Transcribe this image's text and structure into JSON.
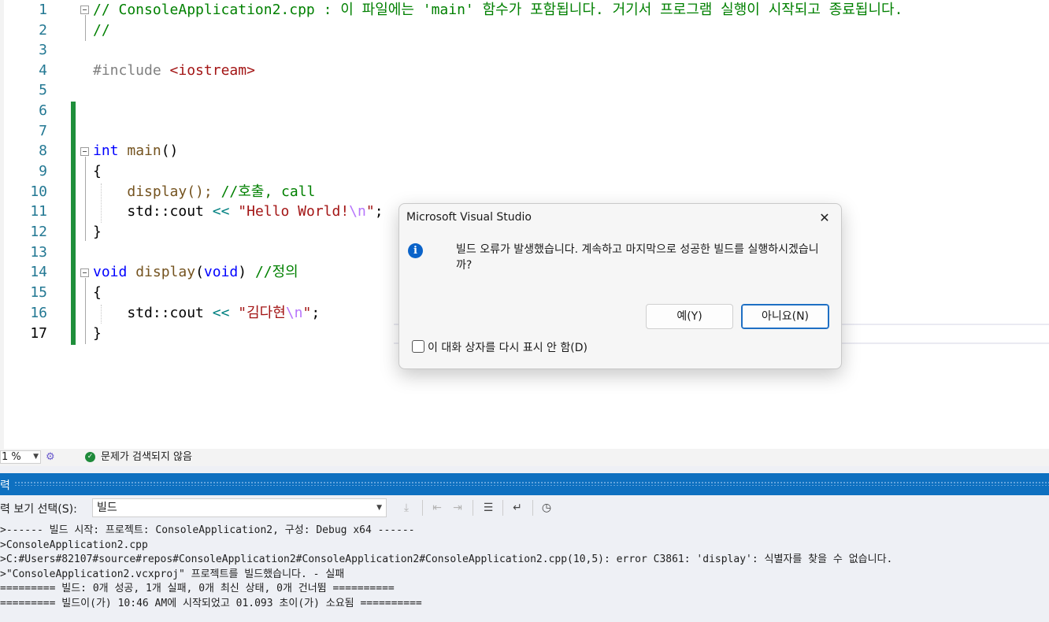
{
  "editor": {
    "line_numbers": [
      "1",
      "2",
      "3",
      "4",
      "5",
      "6",
      "7",
      "8",
      "9",
      "10",
      "11",
      "12",
      "13",
      "14",
      "15",
      "16",
      "17"
    ],
    "lines": {
      "l1": "// ConsoleApplication2.cpp : 이 파일에는 'main' 함수가 포함됩니다. 거기서 프로그램 실행이 시작되고 종료됩니다.",
      "l2": "//",
      "l4_directive": "#include",
      "l4_header": "<iostream>",
      "l8_kw": "int",
      "l8_fn": "main",
      "l8_rest": "()",
      "l9": "{",
      "l10_call": "display();",
      "l10_comment": "//호출, call",
      "l11_a": "std::cout",
      "l11_op": "<<",
      "l11_str1": "\"Hello World!",
      "l11_esc": "\\n",
      "l11_str2": "\"",
      "l11_end": ";",
      "l12": "}",
      "l14_kw": "void",
      "l14_fn": "display",
      "l14_p1": "(",
      "l14_kw2": "void",
      "l14_p2": ")",
      "l14_comment": "//정의",
      "l15": "{",
      "l16_a": "std::cout",
      "l16_op": "<<",
      "l16_str1": "\"김다현",
      "l16_esc": "\\n",
      "l16_str2": "\"",
      "l16_end": ";",
      "l17": "}"
    }
  },
  "statusbar": {
    "zoom": "1 %",
    "issues_text": "문제가 검색되지 않음"
  },
  "output_panel": {
    "title": "력",
    "show_output_label": "력 보기 선택(S):",
    "show_output_value": "빌드",
    "lines": [
      ">------ 빌드 시작: 프로젝트: ConsoleApplication2, 구성: Debug x64 ------",
      ">ConsoleApplication2.cpp",
      ">C:#Users#82107#source#repos#ConsoleApplication2#ConsoleApplication2#ConsoleApplication2.cpp(10,5): error C3861: 'display': 식별자를 찾을 수 없습니다.",
      ">\"ConsoleApplication2.vcxproj\" 프로젝트를 빌드했습니다. - 실패",
      "========= 빌드: 0개 성공, 1개 실패, 0개 최신 상태, 0개 건너뜀 ==========",
      "========= 빌드이(가) 10:46 AM에 시작되었고 01.093 초이(가) 소요됨 =========="
    ]
  },
  "dialog": {
    "title": "Microsoft Visual Studio",
    "message": "빌드 오류가 발생했습니다. 계속하고 마지막으로 성공한 빌드를 실행하시겠습니까?",
    "yes_label": "예(Y)",
    "no_label": "아니요(N)",
    "checkbox_label": "이 대화 상자를 다시 표시 안 함(D)"
  }
}
